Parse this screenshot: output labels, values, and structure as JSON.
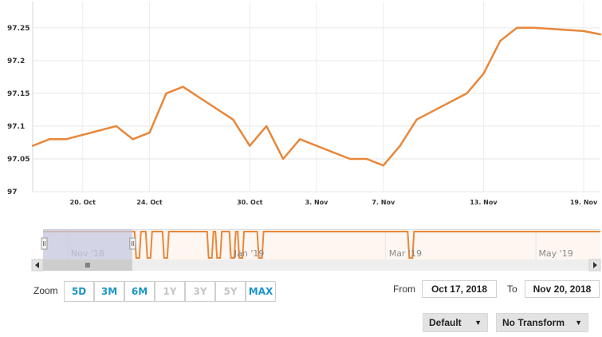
{
  "chart_data": {
    "type": "line",
    "series": [
      {
        "x": [
          "2018-10-17",
          "2018-10-18",
          "2018-10-19",
          "2018-10-22",
          "2018-10-23",
          "2018-10-24",
          "2018-10-25",
          "2018-10-26",
          "2018-10-29",
          "2018-10-30",
          "2018-10-31",
          "2018-11-01",
          "2018-11-02",
          "2018-11-05",
          "2018-11-06",
          "2018-11-07",
          "2018-11-08",
          "2018-11-09",
          "2018-11-12",
          "2018-11-13",
          "2018-11-14",
          "2018-11-15",
          "2018-11-16",
          "2018-11-19",
          "2018-11-20"
        ],
        "values": [
          97.07,
          97.08,
          97.08,
          97.1,
          97.08,
          97.09,
          97.15,
          97.16,
          97.11,
          97.07,
          97.1,
          97.05,
          97.08,
          97.05,
          97.05,
          97.04,
          97.07,
          97.11,
          97.15,
          97.18,
          97.23,
          97.25,
          97.25,
          97.245,
          97.24
        ],
        "color": "#e8873a"
      }
    ],
    "x_ticks": [
      {
        "date": "2018-10-20",
        "label": "20. Oct"
      },
      {
        "date": "2018-10-24",
        "label": "24. Oct"
      },
      {
        "date": "2018-10-30",
        "label": "30. Oct"
      },
      {
        "date": "2018-11-03",
        "label": "3. Nov"
      },
      {
        "date": "2018-11-07",
        "label": "7. Nov"
      },
      {
        "date": "2018-11-13",
        "label": "13. Nov"
      },
      {
        "date": "2018-11-19",
        "label": "19. Nov"
      }
    ],
    "y_ticks": [
      "97",
      "97.05",
      "97.1",
      "97.15",
      "97.2",
      "97.25"
    ],
    "ylim": [
      97,
      97.29
    ],
    "grid": true
  },
  "navigator": {
    "labels": [
      "Nov '18",
      "Jan '19",
      "Mar '19",
      "May '19"
    ],
    "selection_start": 0.0,
    "selection_end": 0.16
  },
  "zoom": {
    "label": "Zoom",
    "buttons": [
      {
        "label": "5D",
        "enabled": true
      },
      {
        "label": "3M",
        "enabled": true
      },
      {
        "label": "6M",
        "enabled": true
      },
      {
        "label": "1Y",
        "enabled": false
      },
      {
        "label": "3Y",
        "enabled": false
      },
      {
        "label": "5Y",
        "enabled": false
      },
      {
        "label": "MAX",
        "enabled": true
      }
    ]
  },
  "range": {
    "from_label": "From",
    "from_value": "Oct 17, 2018",
    "to_label": "To",
    "to_value": "Nov 20, 2018"
  },
  "controls": {
    "mode_select": "Default",
    "transform_select": "No Transform",
    "arrow": "▼"
  },
  "colors": {
    "line": "#e8873a",
    "accent": "#1a96c8",
    "navigator_mask": "#c4c8e0"
  }
}
